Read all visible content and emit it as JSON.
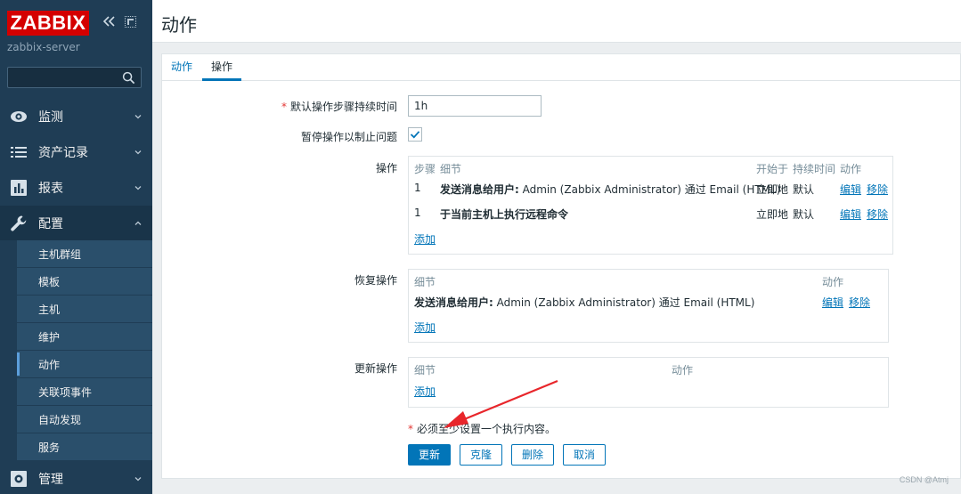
{
  "sidebar": {
    "logo": "ZABBIX",
    "server_name": "zabbix-server",
    "search_value": "",
    "menu": [
      {
        "label": "监测",
        "icon": "eye-icon",
        "open": false
      },
      {
        "label": "资产记录",
        "icon": "list-icon",
        "open": false
      },
      {
        "label": "报表",
        "icon": "bar-chart-icon",
        "open": false
      },
      {
        "label": "配置",
        "icon": "wrench-icon",
        "open": true
      },
      {
        "label": "管理",
        "icon": "gear-icon",
        "open": false
      }
    ],
    "submenu": [
      {
        "label": "主机群组"
      },
      {
        "label": "模板"
      },
      {
        "label": "主机"
      },
      {
        "label": "维护"
      },
      {
        "label": "动作",
        "active": true
      },
      {
        "label": "关联项事件"
      },
      {
        "label": "自动发现"
      },
      {
        "label": "服务"
      }
    ]
  },
  "header": {
    "title": "动作"
  },
  "tabs": [
    "动作",
    "操作"
  ],
  "form": {
    "step_duration_label": "默认操作步骤持续时间",
    "step_duration_value": "1h",
    "pause_label": "暂停操作以制止问题",
    "pause_checked": true,
    "operations_label": "操作",
    "operations_headers": [
      "步骤",
      "细节",
      "开始于",
      "持续时间",
      "动作"
    ],
    "operations_rows": [
      {
        "step": "1",
        "detail_bold": "发送消息给用户:",
        "detail_rest": " Admin (Zabbix Administrator) 通过 Email (HTML)",
        "start": "立即地",
        "duration": "默认",
        "edit": "编辑",
        "remove": "移除"
      },
      {
        "step": "1",
        "detail_bold": "于当前主机上执行远程命令",
        "detail_rest": "",
        "start": "立即地",
        "duration": "默认",
        "edit": "编辑",
        "remove": "移除"
      }
    ],
    "operations_add": "添加",
    "recovery_label": "恢复操作",
    "recovery_headers": [
      "细节",
      "动作"
    ],
    "recovery_rows": [
      {
        "detail_bold": "发送消息给用户:",
        "detail_rest": " Admin (Zabbix Administrator) 通过 Email (HTML)",
        "edit": "编辑",
        "remove": "移除"
      }
    ],
    "recovery_add": "添加",
    "update_label": "更新操作",
    "update_headers": [
      "细节",
      "动作"
    ],
    "update_add": "添加",
    "required_note": "必须至少设置一个执行内容。"
  },
  "buttons": {
    "update": "更新",
    "clone": "克隆",
    "delete": "删除",
    "cancel": "取消"
  },
  "watermark": "CSDN @Atmj",
  "colors": {
    "brand_red": "#d40000",
    "sidebar_bg": "#1f3d55",
    "link_blue": "#0275b8",
    "arrow_red": "#e8262b"
  }
}
